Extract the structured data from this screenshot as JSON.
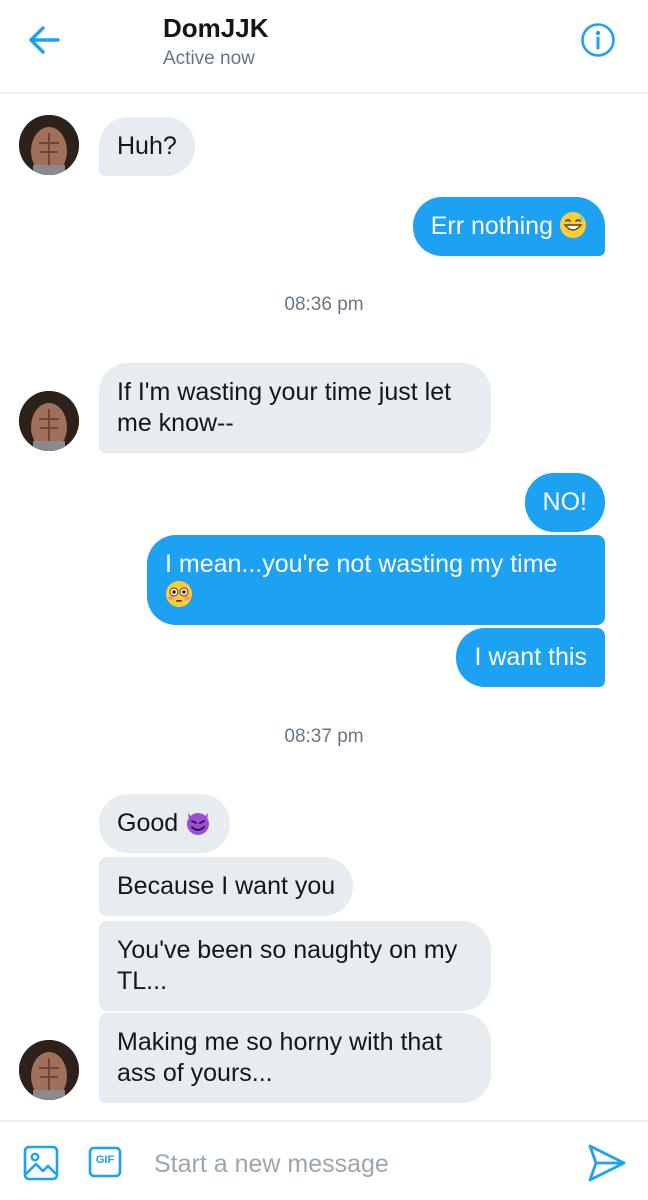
{
  "header": {
    "title": "DomJJK",
    "status": "Active now"
  },
  "messages": [
    {
      "direction": "in",
      "text": "Huh?"
    },
    {
      "direction": "out",
      "text": "Err nothing",
      "emoji": "grinning-sweat-emoji"
    },
    {
      "direction": "in",
      "text": "If I'm wasting your time just let me know--"
    },
    {
      "direction": "out",
      "text": "NO!"
    },
    {
      "direction": "out",
      "text": "I mean...you're not wasting my time",
      "emoji": "flushed-face-emoji"
    },
    {
      "direction": "out",
      "text": "I want this"
    },
    {
      "direction": "in",
      "text": "Good",
      "emoji": "smiling-devil-emoji"
    },
    {
      "direction": "in",
      "text": "Because I want you"
    },
    {
      "direction": "in",
      "text": "You've been so naughty on my TL..."
    },
    {
      "direction": "in",
      "text": "Making me so horny with that ass of yours..."
    }
  ],
  "timestamps": [
    "08:36 pm",
    "08:37 pm"
  ],
  "composer": {
    "placeholder": "Start a new message",
    "gif_label": "GIF"
  },
  "colors": {
    "accent": "#1da1f2",
    "incoming_bubble": "#e6ecf0",
    "secondary_text": "#657786"
  },
  "icons": [
    "back-arrow-icon",
    "info-icon",
    "image-icon",
    "gif-icon",
    "send-icon"
  ]
}
